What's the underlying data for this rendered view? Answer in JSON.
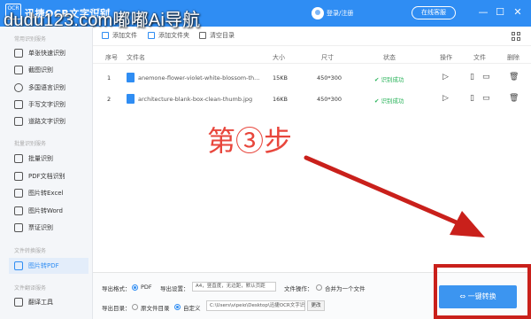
{
  "titlebar": {
    "logo_text": "OCR",
    "title": "迅捷OCR文字识别",
    "version": "v8.7.0.0",
    "watermark": "dudu123.com嘟嘟Ai导航",
    "login_label": "登录/注册",
    "online_help": "在线客服",
    "min_glyph": "—",
    "max_glyph": "☐",
    "close_glyph": "✕"
  },
  "sidebar": {
    "section1": "常用识别服务",
    "section2": "批量识别服务",
    "section3": "文件转换服务",
    "section4": "文件翻译服务",
    "items": [
      {
        "label": "单张快速识别"
      },
      {
        "label": "截图识别"
      },
      {
        "label": "多国语言识别"
      },
      {
        "label": "手写文字识别"
      },
      {
        "label": "道路文字识别"
      },
      {
        "label": "批量识别"
      },
      {
        "label": "PDF文档识别"
      },
      {
        "label": "图片转Excel"
      },
      {
        "label": "图片转Word"
      },
      {
        "label": "票证识别"
      },
      {
        "label": "图片转PDF"
      },
      {
        "label": "翻译工具"
      }
    ]
  },
  "toolbar": {
    "add_file": "添加文件",
    "add_folder": "添加文件夹",
    "clear_list": "清空目录"
  },
  "table": {
    "headers": [
      "序号",
      "文件名",
      "大小",
      "尺寸",
      "状态",
      "操作",
      "文件",
      "删除"
    ],
    "rows": [
      {
        "index": "1",
        "name": "anemone-flower-violet-white-blossom-th...",
        "size": "15KB",
        "dims": "450*300",
        "status": "识别成功"
      },
      {
        "index": "2",
        "name": "architecture-blank-box-clean-thumb.jpg",
        "size": "16KB",
        "dims": "450*300",
        "status": "识别成功"
      }
    ]
  },
  "overlay": {
    "step_text": "第③步"
  },
  "bottom": {
    "format_label": "导出格式：",
    "format_value": "PDF",
    "settings_label": "导出设置：",
    "settings_value": "A4，竖直度，无边距，默认页距",
    "file_op_label": "文件操作：",
    "merge_label": "合并为一个文件",
    "dir_label": "导出目录：",
    "original_dir": "原文件目录",
    "custom_dir": "自定义",
    "path_value": "C:\\Users\\vipeio\\Desktop\\迅捷OCR文字识",
    "change_label": "更改",
    "convert_label": "一键转换"
  },
  "colors": {
    "accent": "#2f8df3",
    "annotation": "#e8463c",
    "frame": "#c9201b",
    "success": "#29b35a"
  }
}
